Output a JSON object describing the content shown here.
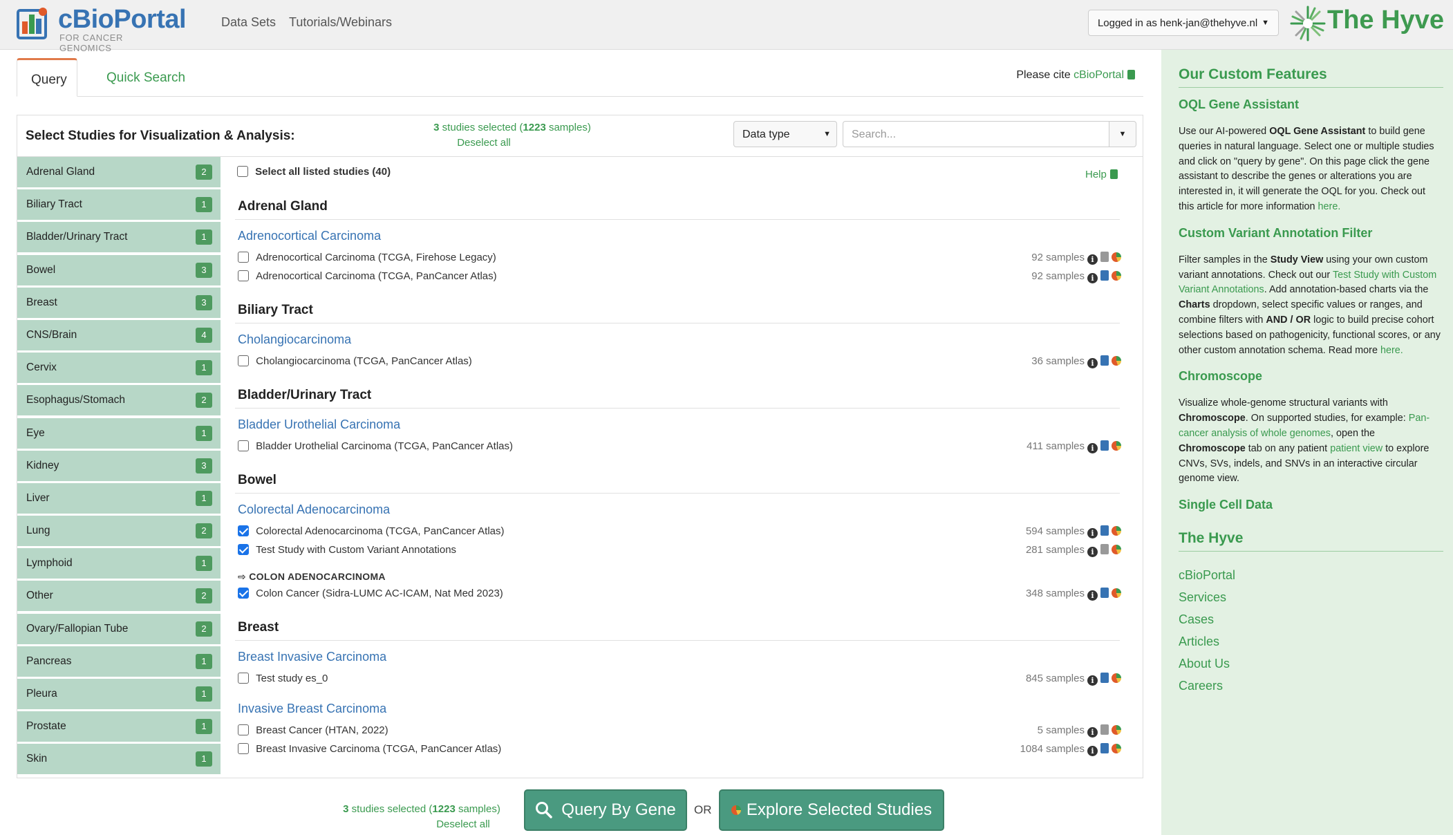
{
  "header": {
    "logo_title": "cBioPortal",
    "logo_subtitle": "FOR CANCER GENOMICS",
    "nav": [
      "Data Sets",
      "Tutorials/Webinars"
    ],
    "login_label": "Logged in as henk-jan@thehyve.nl",
    "brand": "The Hyve"
  },
  "tabs": {
    "query": "Query",
    "quick_search": "Quick Search"
  },
  "cite": {
    "prefix": "Please cite",
    "link": "cBioPortal"
  },
  "panel": {
    "title": "Select Studies for Visualization & Analysis:",
    "selected_count": "3",
    "selected_text_mid": " studies selected (",
    "selected_samples": "1223",
    "selected_text_end": " samples)",
    "deselect": "Deselect all",
    "datatype_label": "Data type",
    "search_placeholder": "Search...",
    "select_all": "Select all listed studies (40)",
    "help": "Help"
  },
  "categories": [
    {
      "name": "Adrenal Gland",
      "count": "2"
    },
    {
      "name": "Biliary Tract",
      "count": "1"
    },
    {
      "name": "Bladder/Urinary Tract",
      "count": "1"
    },
    {
      "name": "Bowel",
      "count": "3"
    },
    {
      "name": "Breast",
      "count": "3"
    },
    {
      "name": "CNS/Brain",
      "count": "4"
    },
    {
      "name": "Cervix",
      "count": "1"
    },
    {
      "name": "Esophagus/Stomach",
      "count": "2"
    },
    {
      "name": "Eye",
      "count": "1"
    },
    {
      "name": "Kidney",
      "count": "3"
    },
    {
      "name": "Liver",
      "count": "1"
    },
    {
      "name": "Lung",
      "count": "2"
    },
    {
      "name": "Lymphoid",
      "count": "1"
    },
    {
      "name": "Other",
      "count": "2"
    },
    {
      "name": "Ovary/Fallopian Tube",
      "count": "2"
    },
    {
      "name": "Pancreas",
      "count": "1"
    },
    {
      "name": "Pleura",
      "count": "1"
    },
    {
      "name": "Prostate",
      "count": "1"
    },
    {
      "name": "Skin",
      "count": "1"
    }
  ],
  "groups": {
    "adrenal": "Adrenal Gland",
    "biliary": "Biliary Tract",
    "bladder": "Bladder/Urinary Tract",
    "bowel": "Bowel",
    "breast": "Breast"
  },
  "subtypes": {
    "acc": "Adrenocortical Carcinoma",
    "chol": "Cholangiocarcinoma",
    "blca": "Bladder Urothelial Carcinoma",
    "coad": "Colorectal Adenocarcinoma",
    "colon": "COLON ADENOCARCINOMA",
    "brca": "Breast Invasive Carcinoma",
    "ibc": "Invasive Breast Carcinoma"
  },
  "studies": [
    {
      "name": "Adrenocortical Carcinoma (TCGA, Firehose Legacy)",
      "samples": "92 samples",
      "checked": false
    },
    {
      "name": "Adrenocortical Carcinoma (TCGA, PanCancer Atlas)",
      "samples": "92 samples",
      "checked": false
    },
    {
      "name": "Cholangiocarcinoma (TCGA, PanCancer Atlas)",
      "samples": "36 samples",
      "checked": false
    },
    {
      "name": "Bladder Urothelial Carcinoma (TCGA, PanCancer Atlas)",
      "samples": "411 samples",
      "checked": false
    },
    {
      "name": "Colorectal Adenocarcinoma (TCGA, PanCancer Atlas)",
      "samples": "594 samples",
      "checked": true
    },
    {
      "name": "Test Study with Custom Variant Annotations",
      "samples": "281 samples",
      "checked": true
    },
    {
      "name": "Colon Cancer (Sidra-LUMC AC-ICAM, Nat Med 2023)",
      "samples": "348 samples",
      "checked": true
    },
    {
      "name": "Test study es_0",
      "samples": "845 samples",
      "checked": false
    },
    {
      "name": "Breast Cancer (HTAN, 2022)",
      "samples": "5 samples",
      "checked": false
    },
    {
      "name": "Breast Invasive Carcinoma (TCGA, PanCancer Atlas)",
      "samples": "1084 samples",
      "checked": false
    }
  ],
  "bottom": {
    "query_by_gene": "Query By Gene",
    "or": "OR",
    "explore": "Explore Selected Studies"
  },
  "sidebar": {
    "title": "Our Custom Features",
    "oql_title": "OQL Gene Assistant",
    "oql_p1": "Use our AI-powered ",
    "oql_bold": "OQL Gene Assistant",
    "oql_p2": " to build gene queries in natural language. Select one or multiple studies and click on \"query by gene\". On this page click the gene assistant to describe the genes or alterations you are interested in, it will generate the OQL for you. Check out this article for more information ",
    "oql_link": "here.",
    "cva_title": "Custom Variant Annotation Filter",
    "cva_p1": "Filter samples in the ",
    "cva_b1": "Study View",
    "cva_p2": " using your own custom variant annotations. Check out our ",
    "cva_link1": "Test Study with Custom Variant Annotations",
    "cva_p3": ". Add annotation-based charts via the ",
    "cva_b2": "Charts",
    "cva_p4": " dropdown, select specific values or ranges, and combine filters with ",
    "cva_b3": "AND / OR",
    "cva_p5": " logic to build precise cohort selections based on pathogenicity, functional scores, or any other custom annotation schema. Read more ",
    "cva_link2": "here.",
    "chrom_title": "Chromoscope",
    "chrom_p1": "Visualize whole-genome structural variants with ",
    "chrom_b1": "Chromoscope",
    "chrom_p2": ". On supported studies, for example: ",
    "chrom_link1": "Pan-cancer analysis of whole genomes",
    "chrom_p3": ", open the ",
    "chrom_b2": "Chromoscope",
    "chrom_p4": " tab on any patient ",
    "chrom_link2": "patient view",
    "chrom_p5": " to explore CNVs, SVs, indels, and SNVs in an interactive circular genome view.",
    "single_cell": "Single Cell Data",
    "hyve_title": "The Hyve",
    "hyve_links": [
      "cBioPortal",
      "Services",
      "Cases",
      "Articles",
      "About Us",
      "Careers"
    ]
  }
}
